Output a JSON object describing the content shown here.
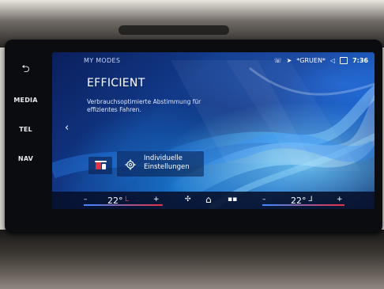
{
  "side_keys": {
    "back_symbol": "⮌",
    "media": "MEDIA",
    "tel": "TEL",
    "nav": "NAV"
  },
  "status_bar": {
    "profile": "*GRUEN*",
    "time": "7:36"
  },
  "mode": {
    "header": "MY MODES",
    "title": "EFFICIENT",
    "description": "Verbrauchsoptimierte Abstimmung für effizientes Fahren."
  },
  "actions": {
    "settings_label_line1": "Individuelle",
    "settings_label_line2": "Einstellungen"
  },
  "climate": {
    "left_minus": "–",
    "left_temp": "22°",
    "left_plus": "+",
    "right_minus": "–",
    "right_temp": "22°",
    "right_plus": "+"
  },
  "colors": {
    "accent_red": "#e8323b",
    "accent_blue": "#3d8bff",
    "screen_bg": "#0e2d78"
  }
}
